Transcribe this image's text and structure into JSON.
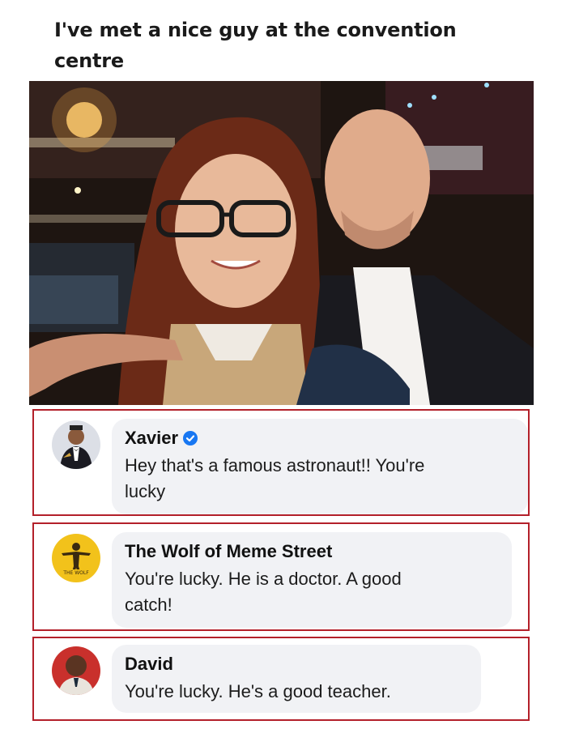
{
  "post": {
    "title_line1": "I've met a nice guy at the convention",
    "title_line2": "centre"
  },
  "comments": [
    {
      "name": "Xavier",
      "verified": true,
      "text_line1": "Hey that's a famous astronaut!! You're",
      "text_line2": "lucky"
    },
    {
      "name": "The Wolf of Meme Street",
      "verified": false,
      "text_line1": "You're lucky. He is a doctor. A good",
      "text_line2": "catch!",
      "avatar_text": "THE WOLF"
    },
    {
      "name": "David",
      "verified": false,
      "text_line1": "You're lucky. He's a good teacher.",
      "text_line2": ""
    }
  ],
  "colors": {
    "highlight_border": "#b3202a",
    "bubble_bg": "#f1f2f5",
    "verified_badge": "#1877f2"
  },
  "icons": [
    "verified-badge-icon"
  ]
}
